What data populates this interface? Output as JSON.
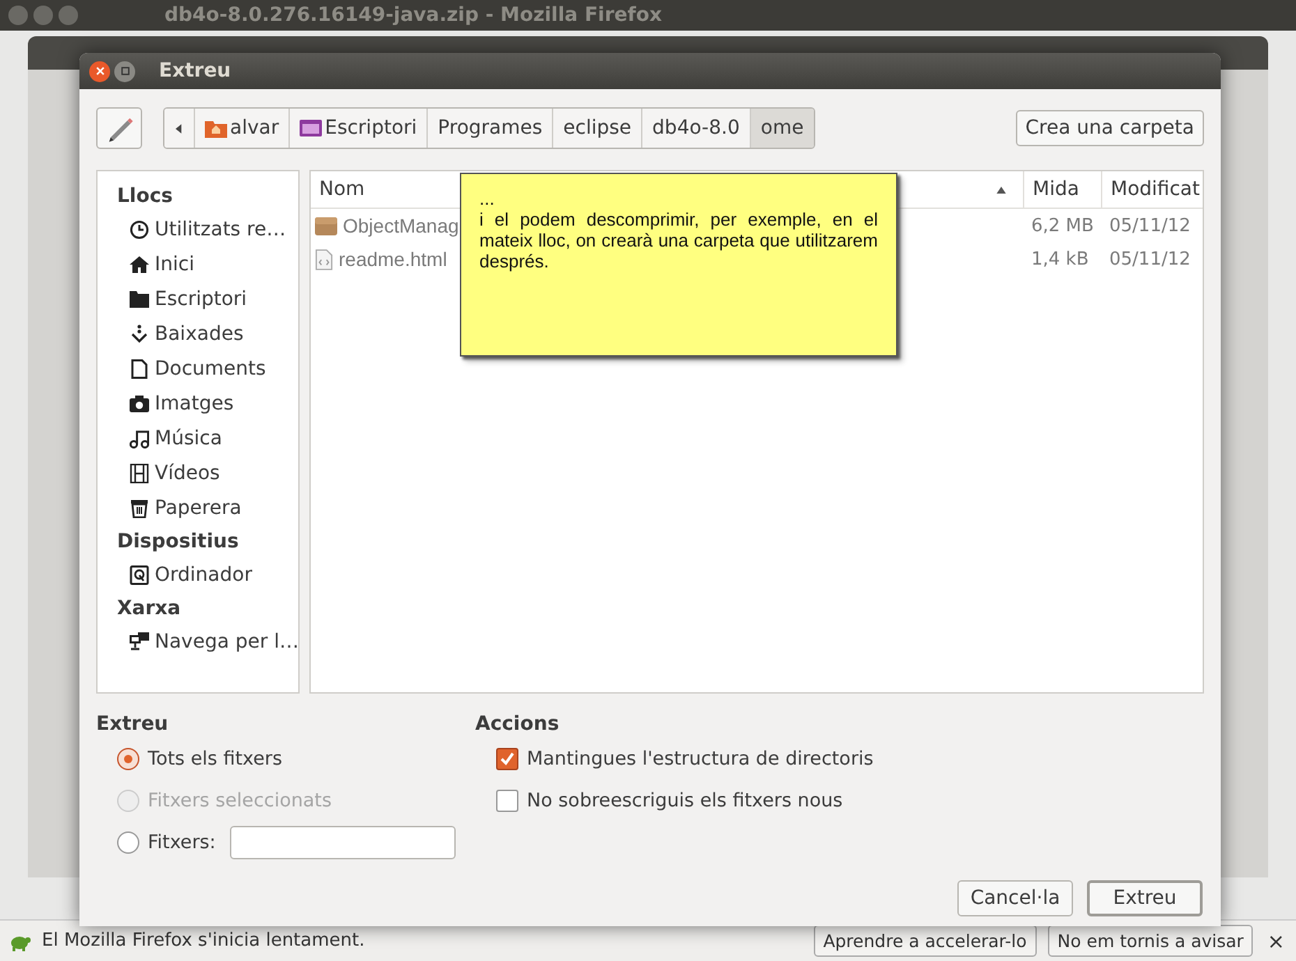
{
  "browser": {
    "title": "db4o-8.0.276.16149-java.zip - Mozilla Firefox",
    "notification": {
      "text": "El Mozilla Firefox s'inicia lentament.",
      "buttons": [
        "Aprendre a accelerar-lo",
        "No em tornis a avisar"
      ],
      "close": "×"
    }
  },
  "dialog": {
    "title": "Extreu",
    "path": [
      {
        "label": "alvar",
        "selected": false
      },
      {
        "label": "Escriptori",
        "selected": false
      },
      {
        "label": "Programes",
        "selected": false
      },
      {
        "label": "eclipse",
        "selected": false
      },
      {
        "label": "db4o-8.0",
        "selected": false
      },
      {
        "label": "ome",
        "selected": true
      }
    ],
    "new_folder": "Crea una carpeta",
    "places": [
      {
        "heading": "Llocs",
        "items": [
          {
            "label": "Utilitzats re…"
          },
          {
            "label": "Inici"
          },
          {
            "label": "Escriptori"
          },
          {
            "label": "Baixades"
          },
          {
            "label": "Documents"
          },
          {
            "label": "Imatges"
          },
          {
            "label": "Música"
          },
          {
            "label": "Vídeos"
          },
          {
            "label": "Paperera"
          }
        ]
      },
      {
        "heading": "Dispositius",
        "items": [
          {
            "label": "Ordinador"
          }
        ]
      },
      {
        "heading": "Xarxa",
        "items": [
          {
            "label": "Navega per l…"
          }
        ]
      }
    ],
    "files": {
      "columns": [
        "Nom",
        "Mida",
        "Modificat"
      ],
      "rows": [
        {
          "name": "ObjectManag",
          "size": "6,2 MB",
          "modified": "05/11/12"
        },
        {
          "name": "readme.html",
          "size": "1,4 kB",
          "modified": "05/11/12"
        }
      ]
    },
    "note": {
      "lines": [
        "...",
        "i el podem descomprimir, per exemple, en el mateix lloc, on crearà una carpeta que utilitzarem després."
      ]
    },
    "extract": {
      "title": "Extreu",
      "options": [
        {
          "kind": "radio",
          "label": "Tots els fitxers",
          "selected": true,
          "disabled": false
        },
        {
          "kind": "radio",
          "label": "Fitxers seleccionats",
          "selected": false,
          "disabled": true
        },
        {
          "kind": "radio_field",
          "label": "Fitxers:",
          "selected": false,
          "disabled": false
        }
      ]
    },
    "actions": {
      "title": "Accions",
      "options": [
        {
          "label": "Mantingues l'estructura de directoris",
          "checked": true
        },
        {
          "label": "No sobreescriguis els fitxers nous",
          "checked": false
        }
      ]
    },
    "buttons": [
      {
        "label": "Cancel·la",
        "default": false
      },
      {
        "label": "Extreu",
        "default": true
      }
    ]
  }
}
